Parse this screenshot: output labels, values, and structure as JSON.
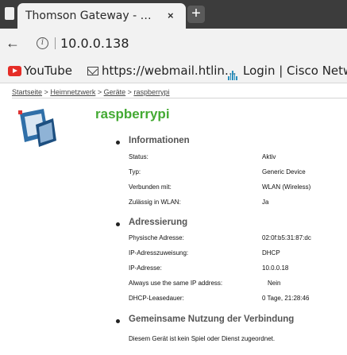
{
  "browser": {
    "tab_title": "Thomson Gateway - …",
    "tab_close": "×",
    "new_tab": "+",
    "back": "←",
    "info": "i",
    "url": "10.0.0.138",
    "bookmarks": [
      {
        "label": "YouTube"
      },
      {
        "label": "https://webmail.htlin…"
      },
      {
        "label": "Login | Cisco Netw"
      }
    ]
  },
  "page": {
    "breadcrumb": [
      "Startseite",
      "Heimnetzwerk",
      "Geräte",
      "raspberrypi"
    ],
    "breadcrumb_sep": ">",
    "device_name": "raspberrypi",
    "sections": [
      {
        "title": "Informationen",
        "rows": [
          {
            "label": "Status:",
            "value": "Aktiv"
          },
          {
            "label": "Typ:",
            "value": "Generic Device"
          },
          {
            "label": "Verbunden mit:",
            "value": "WLAN (Wireless)"
          },
          {
            "label": "Zulässig in WLAN:",
            "value": "Ja"
          }
        ]
      },
      {
        "title": "Adressierung",
        "rows": [
          {
            "label": "Physische Adresse:",
            "value": "02:0f:b5:31:87:dc"
          },
          {
            "label": "IP-Adresszuweisung:",
            "value": "DHCP"
          },
          {
            "label": "IP-Adresse:",
            "value": "10.0.0.18"
          },
          {
            "label": "Always use the same IP address:",
            "value": "Nein"
          },
          {
            "label": "DHCP-Leasedauer:",
            "value": "0 Tage, 21:28:46"
          }
        ]
      },
      {
        "title": "Gemeinsame Nutzung der Verbindung",
        "text": "Diesem Gerät ist kein Spiel oder Dienst zugeordnet."
      }
    ]
  }
}
